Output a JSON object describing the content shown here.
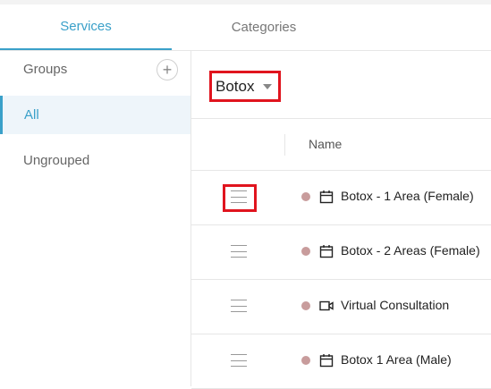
{
  "tabs": {
    "services": "Services",
    "categories": "Categories"
  },
  "sidebar": {
    "groups_label": "Groups",
    "add_icon": "+",
    "items": [
      {
        "label": "All",
        "selected": true
      },
      {
        "label": "Ungrouped",
        "selected": false
      }
    ]
  },
  "filter": {
    "selected": "Botox"
  },
  "table": {
    "column_name": "Name",
    "rows": [
      {
        "name": "Botox - 1 Area (Female)",
        "icon": "calendar-icon"
      },
      {
        "name": "Botox - 2 Areas (Female)",
        "icon": "calendar-icon"
      },
      {
        "name": "Virtual Consultation",
        "icon": "video-icon"
      },
      {
        "name": "Botox 1 Area (Male)",
        "icon": "calendar-icon"
      }
    ]
  },
  "colors": {
    "accent": "#3aa0c9",
    "highlight": "#e0141e",
    "dot": "#c89c9c"
  }
}
